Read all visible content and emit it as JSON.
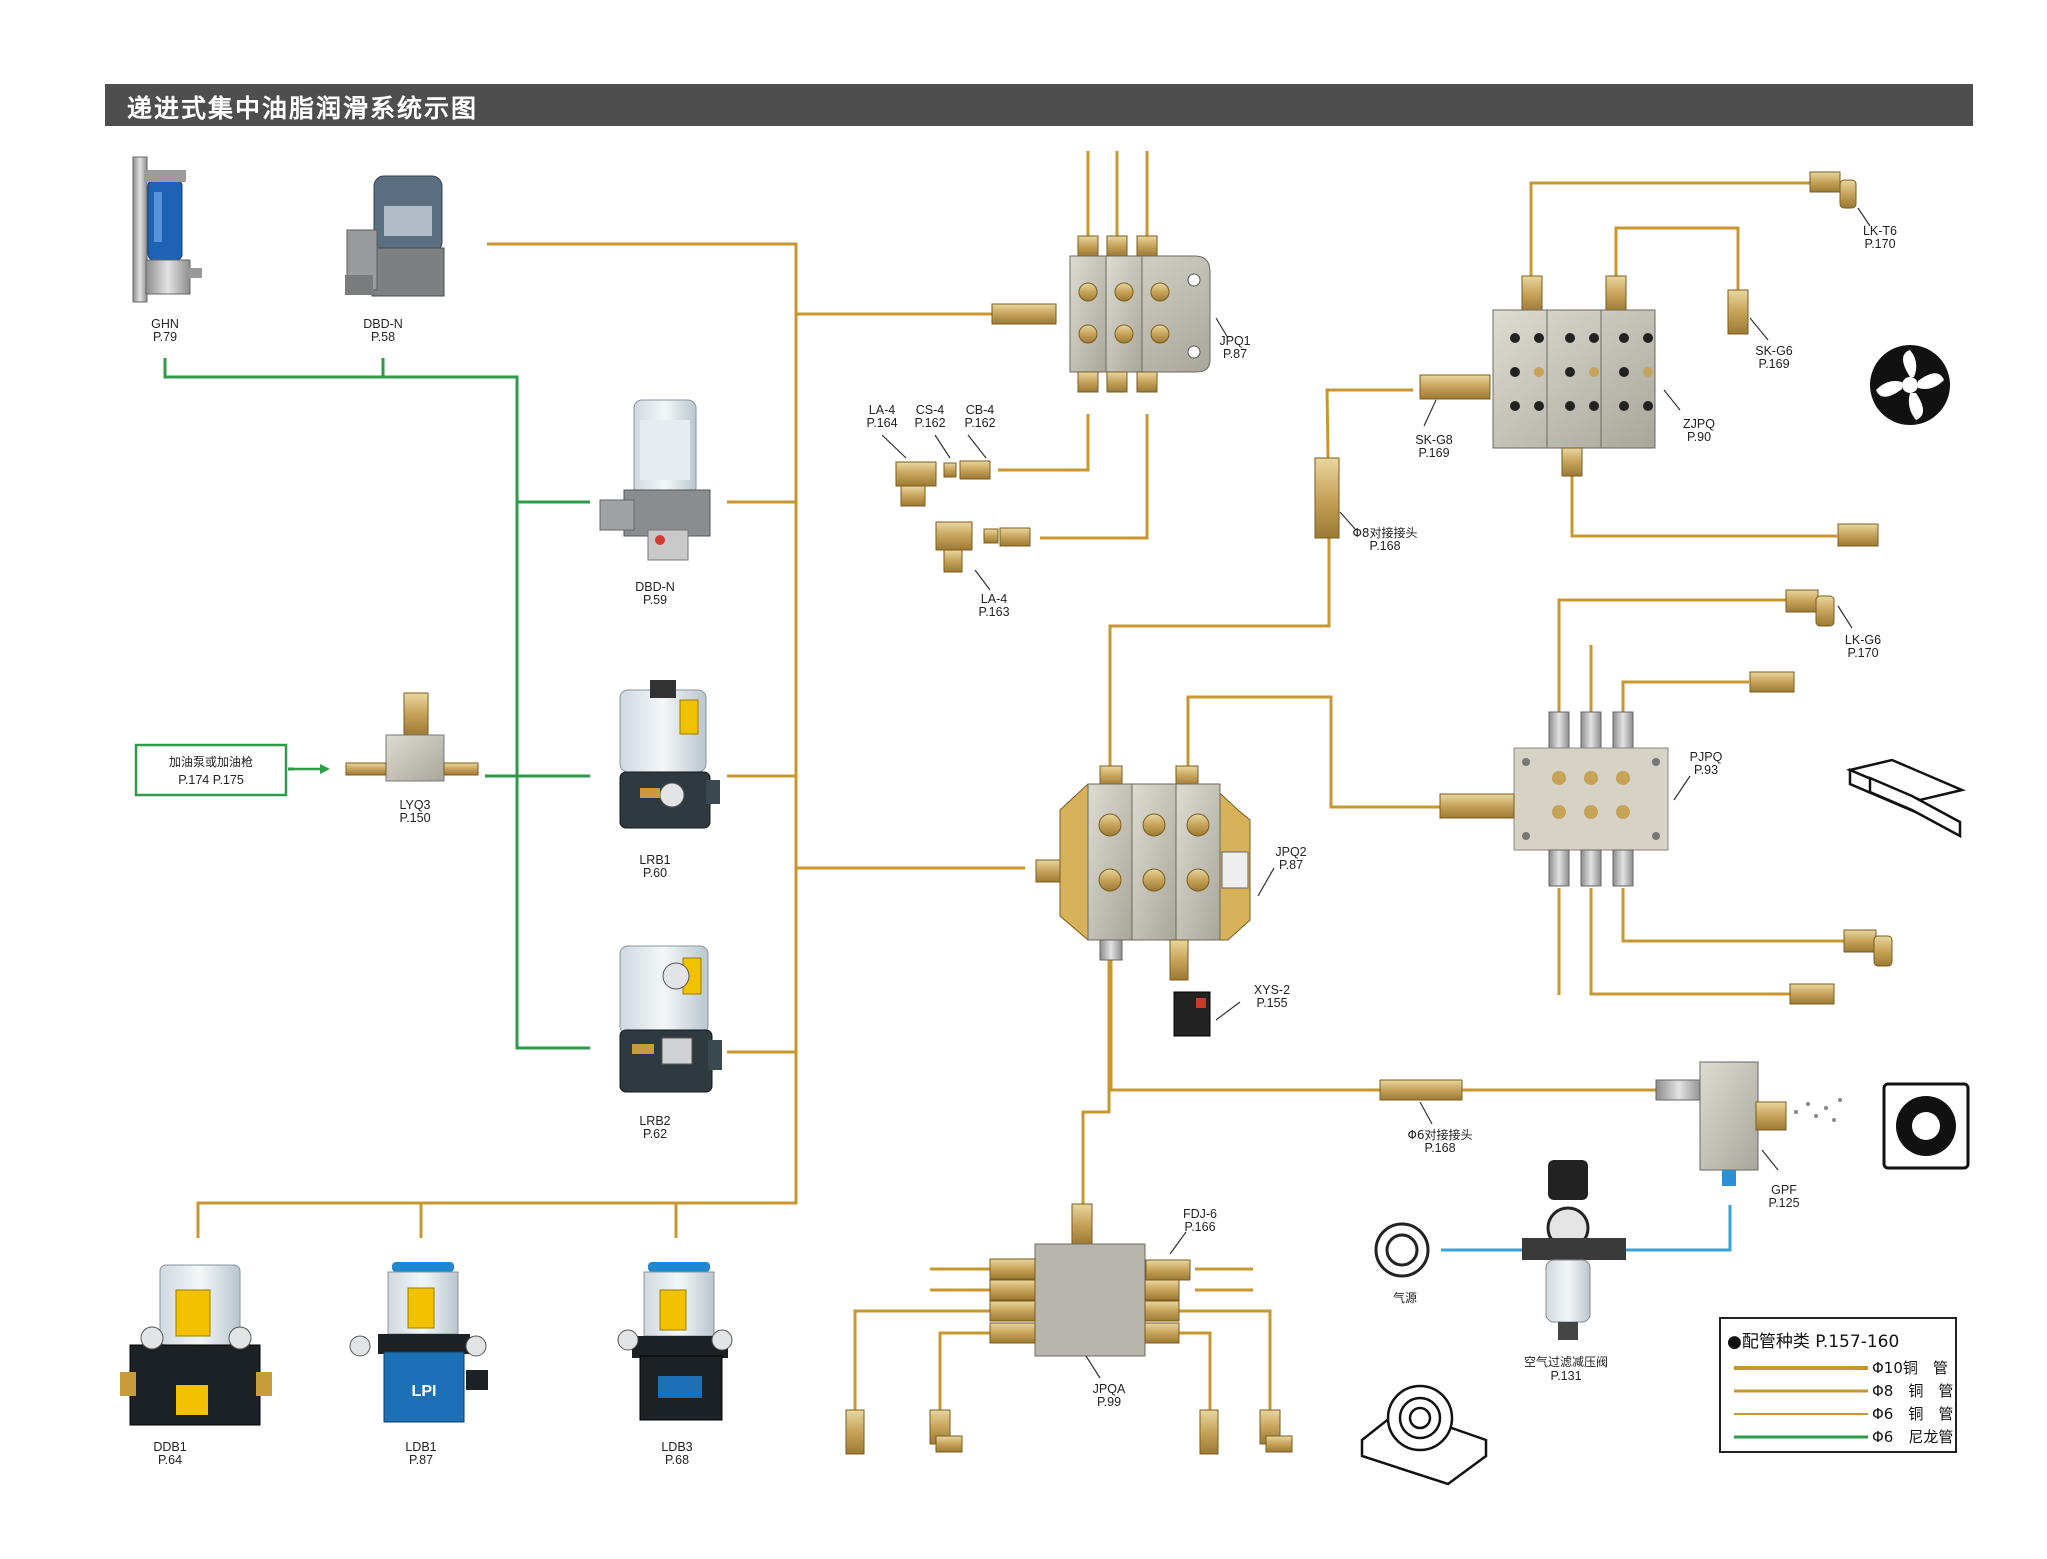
{
  "title": "递进式集中油脂润滑系统示图",
  "colors": {
    "copper_pipe": "#c9972f",
    "nylon_pipe": "#2e9a4a",
    "air_pipe": "#3aa3d9",
    "header_bg": "#4e4e4e"
  },
  "components": {
    "ghn": {
      "name": "GHN",
      "page": "P.79"
    },
    "dbd_n_58": {
      "name": "DBD-N",
      "page": "P.58"
    },
    "dbd_n_59": {
      "name": "DBD-N",
      "page": "P.59"
    },
    "lrb1": {
      "name": "LRB1",
      "page": "P.60"
    },
    "lrb2": {
      "name": "LRB2",
      "page": "P.62"
    },
    "lyq3": {
      "name": "LYQ3",
      "page": "P.150"
    },
    "fill_box": {
      "name": "加油泵或加油枪",
      "page": "P.174  P.175"
    },
    "jpq1": {
      "name": "JPQ1",
      "page": "P.87"
    },
    "la4_164": {
      "name": "LA-4",
      "page": "P.164"
    },
    "cs4": {
      "name": "CS-4",
      "page": "P.162"
    },
    "cb4": {
      "name": "CB-4",
      "page": "P.162"
    },
    "la4_163": {
      "name": "LA-4",
      "page": "P.163"
    },
    "lk_t6": {
      "name": "LK-T6",
      "page": "P.170"
    },
    "sk_g6": {
      "name": "SK-G6",
      "page": "P.169"
    },
    "zjpq": {
      "name": "ZJPQ",
      "page": "P.90"
    },
    "sk_g8": {
      "name": "SK-G8",
      "page": "P.169"
    },
    "phi8_joint": {
      "name": "Φ8对接接头",
      "page": "P.168"
    },
    "lk_g6": {
      "name": "LK-G6",
      "page": "P.170"
    },
    "pjpq": {
      "name": "PJPQ",
      "page": "P.93"
    },
    "jpq2": {
      "name": "JPQ2",
      "page": "P.87"
    },
    "xys2": {
      "name": "XYS-2",
      "page": "P.155"
    },
    "phi6_joint": {
      "name": "Φ6对接接头",
      "page": "P.168"
    },
    "gpf": {
      "name": "GPF",
      "page": "P.125"
    },
    "air_source": {
      "name": "气源"
    },
    "air_filter": {
      "name": "空气过滤减压阀",
      "page": "P.131"
    },
    "fdj6": {
      "name": "FDJ-6",
      "page": "P.166"
    },
    "jpqa": {
      "name": "JPQA",
      "page": "P.99"
    },
    "ddb1": {
      "name": "DDB1",
      "page": "P.64"
    },
    "ldb1": {
      "name": "LDB1",
      "page": "P.87"
    },
    "ldb3": {
      "name": "LDB3",
      "page": "P.68"
    }
  },
  "legend": {
    "title": "●配管种类 P.157-160",
    "items": [
      {
        "spec": "Φ10铜　管",
        "color": "#c9972f"
      },
      {
        "spec": "Φ8　铜　管",
        "color": "#c9972f"
      },
      {
        "spec": "Φ6　铜　管",
        "color": "#c9972f"
      },
      {
        "spec": "Φ6　尼龙管",
        "color": "#2e9a4a"
      }
    ]
  }
}
